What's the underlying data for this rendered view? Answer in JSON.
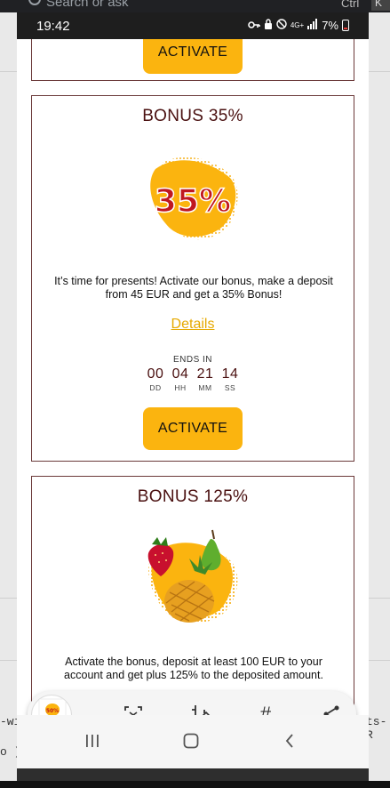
{
  "background": {
    "search_text": "Search or ask",
    "ctrl_text": "Ctrl",
    "k_text": "K",
    "left_fragments": [
      "-wi",
      "o )"
    ],
    "right_fragments": [
      "ts-R"
    ]
  },
  "status_bar": {
    "time": "19:42",
    "network": "4G+",
    "battery_text": "7%",
    "icons": [
      "key-icon",
      "lock-icon",
      "do-not-disturb-icon",
      "signal-icon",
      "battery-icon"
    ]
  },
  "cards": {
    "previous": {
      "button_label": "ACTIVATE"
    },
    "bonus35": {
      "title": "BONUS 35%",
      "image_text": "35%",
      "description": "It’s time for presents! Activate our bonus, make a deposit from 45 EUR and get a 35% Bonus!",
      "details_label": "Details",
      "ends_label": "ENDS IN",
      "timer": [
        {
          "value": "00",
          "unit": "DD"
        },
        {
          "value": "04",
          "unit": "HH"
        },
        {
          "value": "21",
          "unit": "MM"
        },
        {
          "value": "14",
          "unit": "SS"
        }
      ],
      "button_label": "ACTIVATE"
    },
    "bonus125": {
      "title": "BONUS 125%",
      "description": "Activate the bonus, deposit at least 100 EUR to your account and get plus 125% to the deposited amount."
    }
  },
  "toolbar": {
    "thumb_text": "50%",
    "items": [
      "scan-text-icon",
      "edit-crop-icon",
      "hashtag-icon",
      "share-icon"
    ],
    "hash_glyph": "#"
  },
  "colors": {
    "accent": "#fbb40f",
    "title": "#4a1010",
    "border": "#6b3a3a",
    "details": "#e6a900"
  }
}
